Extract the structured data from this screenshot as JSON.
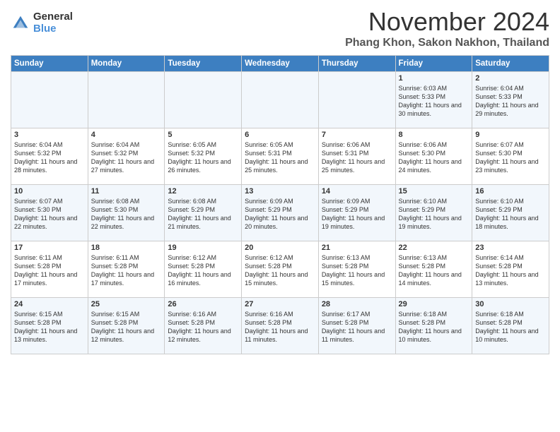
{
  "logo": {
    "general": "General",
    "blue": "Blue"
  },
  "title": "November 2024",
  "location": "Phang Khon, Sakon Nakhon, Thailand",
  "headers": [
    "Sunday",
    "Monday",
    "Tuesday",
    "Wednesday",
    "Thursday",
    "Friday",
    "Saturday"
  ],
  "weeks": [
    [
      {
        "day": "",
        "detail": ""
      },
      {
        "day": "",
        "detail": ""
      },
      {
        "day": "",
        "detail": ""
      },
      {
        "day": "",
        "detail": ""
      },
      {
        "day": "",
        "detail": ""
      },
      {
        "day": "1",
        "detail": "Sunrise: 6:03 AM\nSunset: 5:33 PM\nDaylight: 11 hours and 30 minutes."
      },
      {
        "day": "2",
        "detail": "Sunrise: 6:04 AM\nSunset: 5:33 PM\nDaylight: 11 hours and 29 minutes."
      }
    ],
    [
      {
        "day": "3",
        "detail": "Sunrise: 6:04 AM\nSunset: 5:32 PM\nDaylight: 11 hours and 28 minutes."
      },
      {
        "day": "4",
        "detail": "Sunrise: 6:04 AM\nSunset: 5:32 PM\nDaylight: 11 hours and 27 minutes."
      },
      {
        "day": "5",
        "detail": "Sunrise: 6:05 AM\nSunset: 5:32 PM\nDaylight: 11 hours and 26 minutes."
      },
      {
        "day": "6",
        "detail": "Sunrise: 6:05 AM\nSunset: 5:31 PM\nDaylight: 11 hours and 25 minutes."
      },
      {
        "day": "7",
        "detail": "Sunrise: 6:06 AM\nSunset: 5:31 PM\nDaylight: 11 hours and 25 minutes."
      },
      {
        "day": "8",
        "detail": "Sunrise: 6:06 AM\nSunset: 5:30 PM\nDaylight: 11 hours and 24 minutes."
      },
      {
        "day": "9",
        "detail": "Sunrise: 6:07 AM\nSunset: 5:30 PM\nDaylight: 11 hours and 23 minutes."
      }
    ],
    [
      {
        "day": "10",
        "detail": "Sunrise: 6:07 AM\nSunset: 5:30 PM\nDaylight: 11 hours and 22 minutes."
      },
      {
        "day": "11",
        "detail": "Sunrise: 6:08 AM\nSunset: 5:30 PM\nDaylight: 11 hours and 22 minutes."
      },
      {
        "day": "12",
        "detail": "Sunrise: 6:08 AM\nSunset: 5:29 PM\nDaylight: 11 hours and 21 minutes."
      },
      {
        "day": "13",
        "detail": "Sunrise: 6:09 AM\nSunset: 5:29 PM\nDaylight: 11 hours and 20 minutes."
      },
      {
        "day": "14",
        "detail": "Sunrise: 6:09 AM\nSunset: 5:29 PM\nDaylight: 11 hours and 19 minutes."
      },
      {
        "day": "15",
        "detail": "Sunrise: 6:10 AM\nSunset: 5:29 PM\nDaylight: 11 hours and 19 minutes."
      },
      {
        "day": "16",
        "detail": "Sunrise: 6:10 AM\nSunset: 5:29 PM\nDaylight: 11 hours and 18 minutes."
      }
    ],
    [
      {
        "day": "17",
        "detail": "Sunrise: 6:11 AM\nSunset: 5:28 PM\nDaylight: 11 hours and 17 minutes."
      },
      {
        "day": "18",
        "detail": "Sunrise: 6:11 AM\nSunset: 5:28 PM\nDaylight: 11 hours and 17 minutes."
      },
      {
        "day": "19",
        "detail": "Sunrise: 6:12 AM\nSunset: 5:28 PM\nDaylight: 11 hours and 16 minutes."
      },
      {
        "day": "20",
        "detail": "Sunrise: 6:12 AM\nSunset: 5:28 PM\nDaylight: 11 hours and 15 minutes."
      },
      {
        "day": "21",
        "detail": "Sunrise: 6:13 AM\nSunset: 5:28 PM\nDaylight: 11 hours and 15 minutes."
      },
      {
        "day": "22",
        "detail": "Sunrise: 6:13 AM\nSunset: 5:28 PM\nDaylight: 11 hours and 14 minutes."
      },
      {
        "day": "23",
        "detail": "Sunrise: 6:14 AM\nSunset: 5:28 PM\nDaylight: 11 hours and 13 minutes."
      }
    ],
    [
      {
        "day": "24",
        "detail": "Sunrise: 6:15 AM\nSunset: 5:28 PM\nDaylight: 11 hours and 13 minutes."
      },
      {
        "day": "25",
        "detail": "Sunrise: 6:15 AM\nSunset: 5:28 PM\nDaylight: 11 hours and 12 minutes."
      },
      {
        "day": "26",
        "detail": "Sunrise: 6:16 AM\nSunset: 5:28 PM\nDaylight: 11 hours and 12 minutes."
      },
      {
        "day": "27",
        "detail": "Sunrise: 6:16 AM\nSunset: 5:28 PM\nDaylight: 11 hours and 11 minutes."
      },
      {
        "day": "28",
        "detail": "Sunrise: 6:17 AM\nSunset: 5:28 PM\nDaylight: 11 hours and 11 minutes."
      },
      {
        "day": "29",
        "detail": "Sunrise: 6:18 AM\nSunset: 5:28 PM\nDaylight: 11 hours and 10 minutes."
      },
      {
        "day": "30",
        "detail": "Sunrise: 6:18 AM\nSunset: 5:28 PM\nDaylight: 11 hours and 10 minutes."
      }
    ]
  ]
}
